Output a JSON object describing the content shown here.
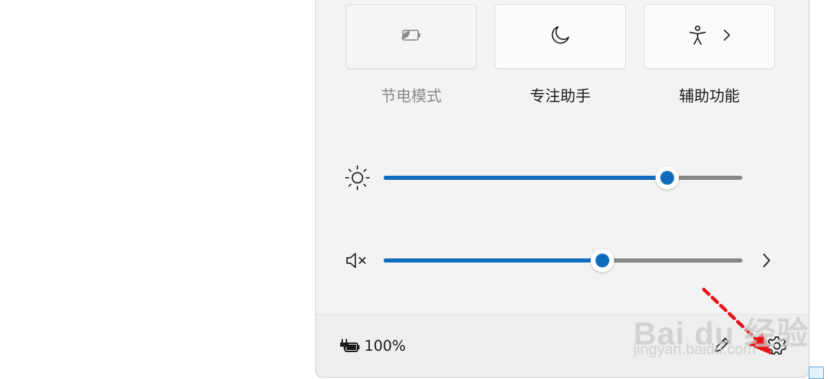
{
  "tiles": [
    {
      "label": "节电模式",
      "icon": "battery-saver-icon",
      "state": "disabled"
    },
    {
      "label": "专注助手",
      "icon": "moon-icon",
      "state": "off"
    },
    {
      "label": "辅助功能",
      "icon": "accessibility-icon",
      "state": "off",
      "has_chevron": true
    }
  ],
  "sliders": {
    "brightness": {
      "icon": "sun-icon",
      "value_percent": 79
    },
    "volume": {
      "icon": "speaker-muted-icon",
      "value_percent": 61,
      "has_chevron": true
    }
  },
  "footer": {
    "battery_icon": "battery-charging-icon",
    "battery_text": "100%",
    "edit_icon": "pencil-icon",
    "settings_icon": "gear-icon"
  },
  "watermark": {
    "brand": "Bai du 经验",
    "url": "jingyan.baidu.com"
  },
  "colors": {
    "accent": "#0f6cbd",
    "panel": "#f3f3f3",
    "track": "#868686",
    "annotation_arrow": "#e8141a"
  }
}
